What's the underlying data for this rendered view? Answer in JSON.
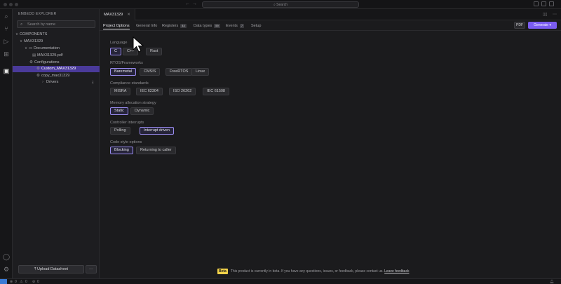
{
  "window": {
    "search_text": "Search"
  },
  "sidebar": {
    "title": "EMBEDD EXPLORER",
    "search_placeholder": "Search by name",
    "tree": [
      {
        "label": "COMPONENTS",
        "chevron": "∨",
        "icon": ""
      },
      {
        "label": "MAX31329",
        "chevron": "∨",
        "icon": ""
      },
      {
        "label": "Documentation",
        "chevron": "∨",
        "icon": "▭"
      },
      {
        "label": "MAX31329.pdf",
        "chevron": "",
        "icon": "▤"
      },
      {
        "label": "Configurations",
        "chevron": "",
        "icon": "⚙"
      },
      {
        "label": "Custom_MAX31329",
        "chevron": "",
        "icon": "⚙"
      },
      {
        "label": "copy_max31329",
        "chevron": "",
        "icon": "⚙"
      },
      {
        "label": "Drivers",
        "chevron": "›",
        "icon": ""
      }
    ],
    "upload_label": "Upload Datasheet",
    "more_label": "···"
  },
  "editor": {
    "tab_title": "MAX31329",
    "tab_close": "✕",
    "subtabs": [
      {
        "label": "Project Options",
        "badge": ""
      },
      {
        "label": "General Info",
        "badge": ""
      },
      {
        "label": "Registers",
        "badge": "44"
      },
      {
        "label": "Data types",
        "badge": "59"
      },
      {
        "label": "Events",
        "badge": "7"
      },
      {
        "label": "Setup",
        "badge": ""
      }
    ],
    "pdf_label": "PDF",
    "generate_label": "Generate"
  },
  "options": {
    "language": {
      "label": "Language",
      "choices": [
        "C",
        "C++",
        "Rust"
      ],
      "selected": 0
    },
    "frameworks": {
      "label": "RTOS/Frameworks",
      "choices": [
        "Baremetal",
        "CMSIS",
        "FreeRTOS",
        "Linux"
      ],
      "selected": 0
    },
    "compliance": {
      "label": "Compliance standards",
      "choices": [
        "MISRA",
        "IEC 62304",
        "ISO 26262",
        "IEC 61508"
      ],
      "selected": -1
    },
    "memory": {
      "label": "Memory allocation strategy",
      "choices": [
        "Static",
        "Dynamic"
      ],
      "selected": 0
    },
    "controller": {
      "label": "Controller interrupts",
      "choices": [
        "Polling",
        "Interrupt driven"
      ],
      "selected": 1
    },
    "code_style": {
      "label": "Code style options",
      "choices": [
        "Blocking",
        "Returning to caller"
      ],
      "selected": 0
    }
  },
  "notice": {
    "tag": "Beta",
    "text": "This product is currently in beta. If you have any questions, issues, or feedback, please contact us.",
    "link": "Leave feedback"
  },
  "status": {
    "errors": "0",
    "warnings": "0"
  }
}
